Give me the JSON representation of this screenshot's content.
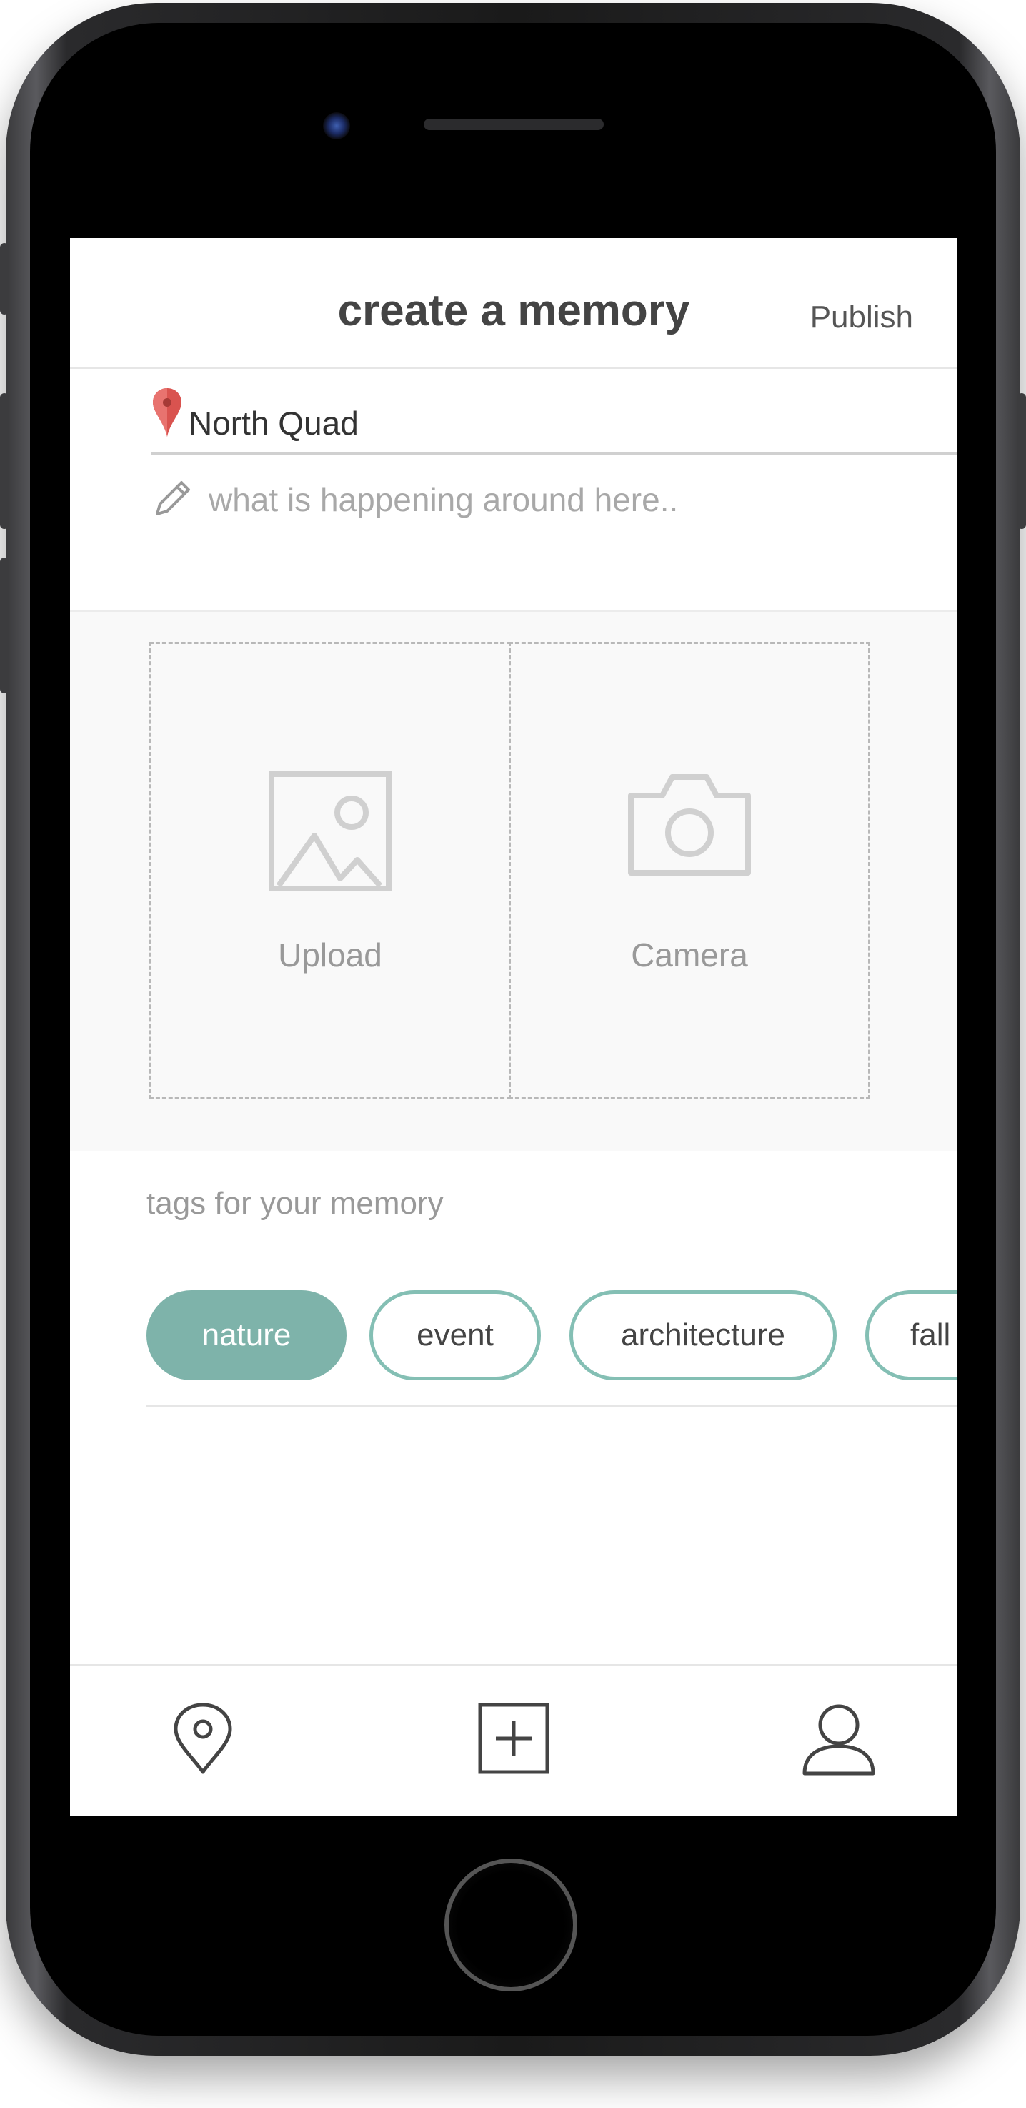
{
  "header": {
    "title": "create a memory",
    "publish_label": "Publish"
  },
  "location": {
    "value": "North Quad",
    "icon": "location-pin-icon",
    "pin_color": "#d9534f"
  },
  "description": {
    "placeholder": "what is happening around here..",
    "value": ""
  },
  "media": {
    "upload_label": "Upload",
    "camera_label": "Camera"
  },
  "tags": {
    "label": "tags for your memory",
    "items": [
      {
        "label": "nature",
        "active": true
      },
      {
        "label": "event",
        "active": false
      },
      {
        "label": "architecture",
        "active": false
      },
      {
        "label": "fall",
        "active": false
      }
    ],
    "accent_color": "#7eb3aa"
  },
  "nav": {
    "items": [
      "map-pin-icon",
      "add-square-icon",
      "profile-icon"
    ]
  }
}
